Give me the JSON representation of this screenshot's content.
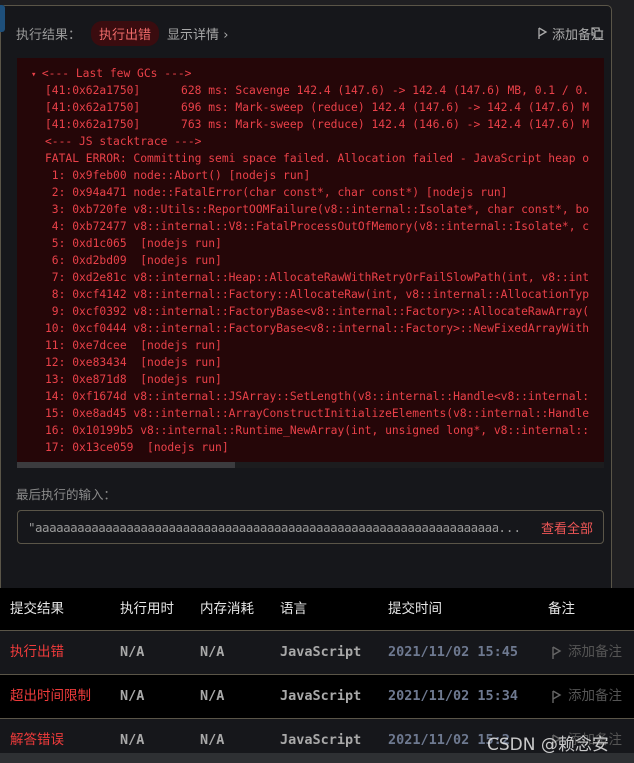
{
  "header": {
    "label": "执行结果：",
    "status": "执行出错",
    "details": "显示详情",
    "add_note": "添加备注"
  },
  "log": {
    "lines": [
      "<--- Last few GCs --->",
      "[41:0x62a1750]      628 ms: Scavenge 142.4 (147.6) -> 142.4 (147.6) MB, 0.1 / 0.",
      "[41:0x62a1750]      696 ms: Mark-sweep (reduce) 142.4 (147.6) -> 142.4 (147.6) M",
      "[41:0x62a1750]      763 ms: Mark-sweep (reduce) 142.4 (146.6) -> 142.4 (147.6) M",
      "<--- JS stacktrace --->",
      "FATAL ERROR: Committing semi space failed. Allocation failed - JavaScript heap o",
      " 1: 0x9feb00 node::Abort() [nodejs run]",
      " 2: 0x94a471 node::FatalError(char const*, char const*) [nodejs run]",
      " 3: 0xb720fe v8::Utils::ReportOOMFailure(v8::internal::Isolate*, char const*, bo",
      " 4: 0xb72477 v8::internal::V8::FatalProcessOutOfMemory(v8::internal::Isolate*, c",
      " 5: 0xd1c065  [nodejs run]",
      " 6: 0xd2bd09  [nodejs run]",
      " 7: 0xd2e81c v8::internal::Heap::AllocateRawWithRetryOrFailSlowPath(int, v8::int",
      " 8: 0xcf4142 v8::internal::Factory::AllocateRaw(int, v8::internal::AllocationTyp",
      " 9: 0xcf0392 v8::internal::FactoryBase<v8::internal::Factory>::AllocateRawArray(",
      "10: 0xcf0444 v8::internal::FactoryBase<v8::internal::Factory>::NewFixedArrayWith",
      "11: 0xe7dcee  [nodejs run]",
      "12: 0xe83434  [nodejs run]",
      "13: 0xe871d8  [nodejs run]",
      "14: 0xf1674d v8::internal::JSArray::SetLength(v8::internal::Handle<v8::internal:",
      "15: 0xe8ad45 v8::internal::ArrayConstructInitializeElements(v8::internal::Handle",
      "16: 0x10199b5 v8::internal::Runtime_NewArray(int, unsigned long*, v8::internal::",
      "17: 0x13ce059  [nodejs run]"
    ]
  },
  "last_input": {
    "label": "最后执行的输入：",
    "value": "\"aaaaaaaaaaaaaaaaaaaaaaaaaaaaaaaaaaaaaaaaaaaaaaaaaaaaaaaaaaaaaaaaaaaaaaaaaaaaaaaa",
    "ellipsis": "...",
    "view_all": "查看全部"
  },
  "table": {
    "columns": [
      "提交结果",
      "执行用时",
      "内存消耗",
      "语言",
      "提交时间",
      "备注"
    ],
    "rows": [
      {
        "result": "执行出错",
        "time": "N/A",
        "memory": "N/A",
        "language": "JavaScript",
        "submitted": "2021/11/02 15:45",
        "note": "添加备注"
      },
      {
        "result": "超出时间限制",
        "time": "N/A",
        "memory": "N/A",
        "language": "JavaScript",
        "submitted": "2021/11/02 15:34",
        "note": "添加备注"
      },
      {
        "result": "解答错误",
        "time": "N/A",
        "memory": "N/A",
        "language": "JavaScript",
        "submitted": "2021/11/02 15:2",
        "note": "添加备注"
      }
    ]
  },
  "watermark": "CSDN @赖念安",
  "colors": {
    "error": "#ea4149",
    "log_bg": "#250608",
    "panel_bg": "#16171b"
  }
}
